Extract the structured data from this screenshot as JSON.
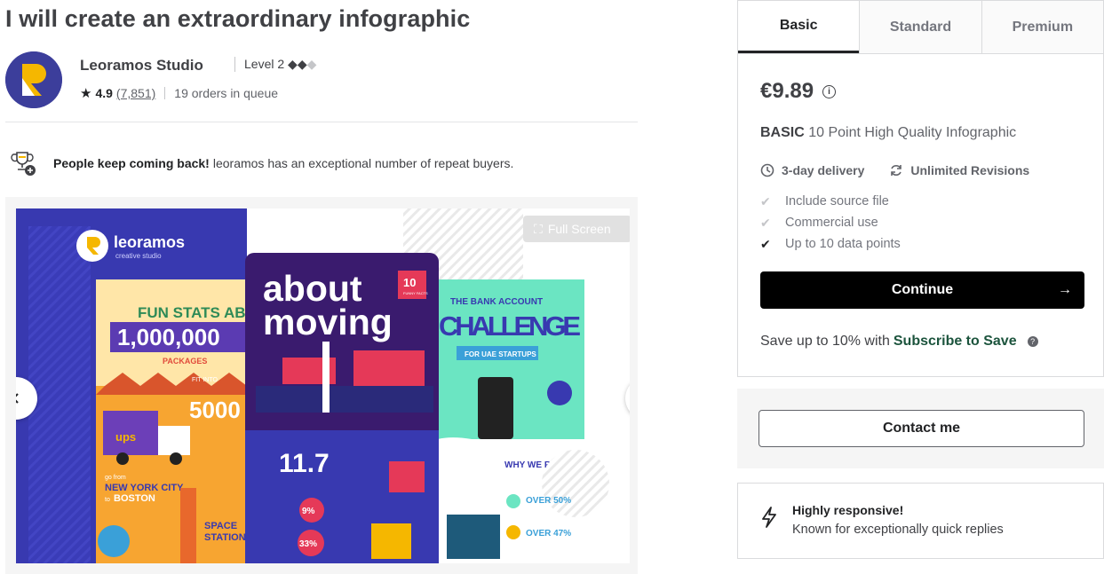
{
  "gig": {
    "title": "I will create an extraordinary infographic"
  },
  "seller": {
    "name": "Leoramos Studio",
    "level": "Level 2",
    "rating": "4.9",
    "reviews": "(7,851)",
    "queue": "19 orders in queue",
    "avatar_colors": [
      "#3c3e9b",
      "#f5b700",
      "#ffffff"
    ]
  },
  "repeat_banner": {
    "bold": "People keep coming back!",
    "text": "leoramos has an exceptional number of repeat buyers."
  },
  "gallery": {
    "fullscreen_label": "Full Screen",
    "prev_icon": "chevron-left-icon",
    "next_icon": "chevron-right-icon",
    "slides": {
      "logo_name": "leoramos",
      "logo_sub": "creative studio",
      "left_poster": {
        "heading": "FUN STATS ABOUT",
        "number": "1,000,000",
        "sub": "PACKAGES",
        "fit_into": "FIT INTO",
        "big_num": "5000",
        "truck_label": "ups",
        "go_from": "go from",
        "city1": "NEW YORK CITY",
        "to": "to",
        "city2": "BOSTON",
        "space1": "SPACE",
        "space2": "STATION"
      },
      "center_poster": {
        "word1": "about",
        "word2": "moving",
        "badge_num": "10",
        "badge_text": "FUNNY FACTS",
        "stat": "11.7",
        "pct1": "9%",
        "pct2": "33%"
      },
      "right_poster": {
        "line1": "THE BANK ACCOUNT",
        "line2": "CHALLENGE",
        "line3": "FOR UAE STARTUPS",
        "question": "WHY WE RESEARCH?",
        "stat1": "OVER 50%",
        "stat2": "OVER 47%"
      }
    }
  },
  "packages": {
    "tabs": [
      "Basic",
      "Standard",
      "Premium"
    ],
    "active_tab": "Basic",
    "price": "€9.89",
    "info_icon": "info-icon",
    "desc_bold": "BASIC",
    "desc": "10 Point High Quality Infographic",
    "delivery": "3-day delivery",
    "revisions": "Unlimited Revisions",
    "features": [
      {
        "label": "Include source file",
        "included": false
      },
      {
        "label": "Commercial use",
        "included": false
      },
      {
        "label": "Up to 10 data points",
        "included": true
      }
    ],
    "continue_label": "Continue",
    "save_prefix": "Save up to 10% with",
    "save_link": "Subscribe to Save"
  },
  "contact": {
    "label": "Contact me"
  },
  "responsive": {
    "title": "Highly responsive!",
    "text": "Known for exceptionally quick replies"
  },
  "colors": {
    "text": "#404145",
    "dark": "#222325",
    "muted": "#62646a",
    "green": "#1c543d",
    "border": "#dadbdd"
  }
}
